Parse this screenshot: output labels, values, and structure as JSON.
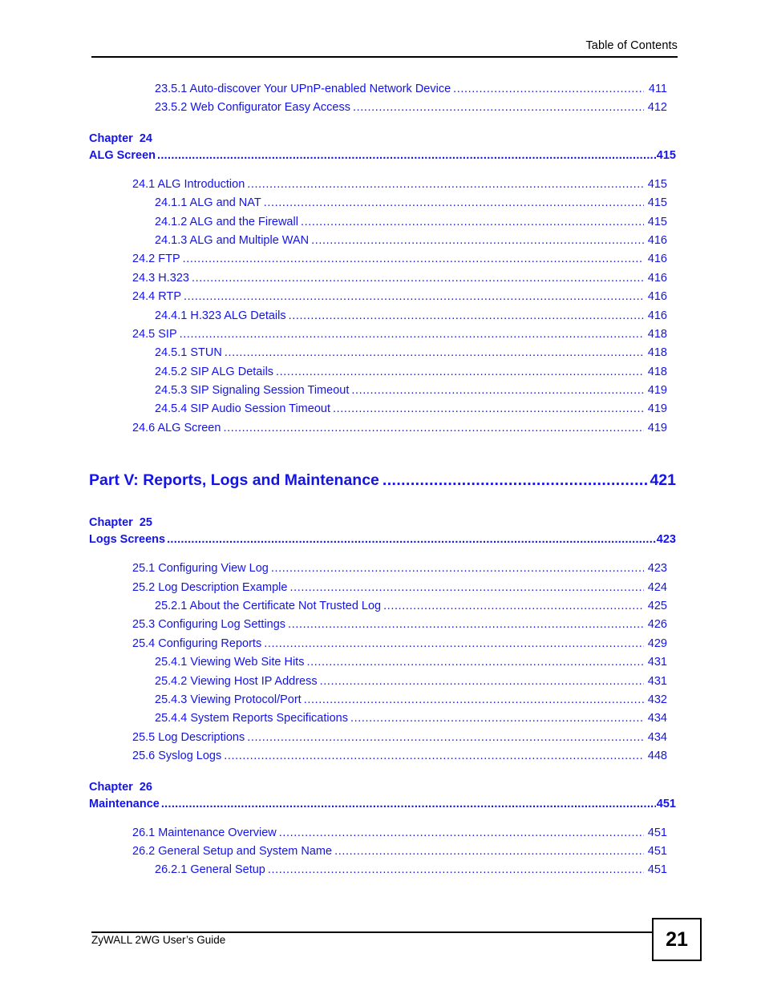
{
  "header": {
    "title": "Table of Contents"
  },
  "footer": {
    "guide_title": "ZyWALL 2WG User’s Guide",
    "page_number": "21"
  },
  "leader": "..................................................................................................................................................................",
  "toc": {
    "top_entries": [
      {
        "level": 3,
        "label": "23.5.1 Auto-discover Your UPnP-enabled Network Device",
        "page": "411"
      },
      {
        "level": 3,
        "label": "23.5.2 Web Configurator Easy Access",
        "page": "412"
      }
    ],
    "chapter_24": {
      "kicker": "Chapter  24",
      "title": "ALG Screen",
      "page": "415",
      "entries": [
        {
          "level": 2,
          "label": "24.1 ALG Introduction",
          "page": "415"
        },
        {
          "level": 3,
          "label": "24.1.1 ALG and NAT",
          "page": "415"
        },
        {
          "level": 3,
          "label": "24.1.2 ALG and the Firewall",
          "page": "415"
        },
        {
          "level": 3,
          "label": "24.1.3 ALG and Multiple WAN",
          "page": "416"
        },
        {
          "level": 2,
          "label": "24.2 FTP",
          "page": "416"
        },
        {
          "level": 2,
          "label": "24.3 H.323",
          "page": "416"
        },
        {
          "level": 2,
          "label": "24.4 RTP",
          "page": "416"
        },
        {
          "level": 3,
          "label": "24.4.1 H.323 ALG Details",
          "page": "416"
        },
        {
          "level": 2,
          "label": "24.5 SIP",
          "page": "418"
        },
        {
          "level": 3,
          "label": "24.5.1 STUN",
          "page": "418"
        },
        {
          "level": 3,
          "label": "24.5.2 SIP ALG Details",
          "page": "418"
        },
        {
          "level": 3,
          "label": "24.5.3 SIP Signaling Session Timeout",
          "page": "419"
        },
        {
          "level": 3,
          "label": "24.5.4 SIP Audio Session Timeout",
          "page": "419"
        },
        {
          "level": 2,
          "label": "24.6 ALG Screen",
          "page": "419"
        }
      ]
    },
    "part_v": {
      "label": "Part V: Reports, Logs and Maintenance",
      "page": "421"
    },
    "chapter_25": {
      "kicker": "Chapter  25",
      "title": "Logs Screens",
      "page": "423",
      "entries": [
        {
          "level": 2,
          "label": "25.1 Configuring View Log",
          "page": "423"
        },
        {
          "level": 2,
          "label": "25.2 Log Description Example",
          "page": "424"
        },
        {
          "level": 3,
          "label": "25.2.1 About the Certificate Not Trusted Log",
          "page": "425"
        },
        {
          "level": 2,
          "label": "25.3 Configuring Log Settings",
          "page": "426"
        },
        {
          "level": 2,
          "label": "25.4 Configuring Reports",
          "page": "429"
        },
        {
          "level": 3,
          "label": "25.4.1 Viewing Web Site Hits",
          "page": "431"
        },
        {
          "level": 3,
          "label": "25.4.2 Viewing Host IP Address",
          "page": "431"
        },
        {
          "level": 3,
          "label": "25.4.3 Viewing Protocol/Port",
          "page": "432"
        },
        {
          "level": 3,
          "label": "25.4.4 System Reports Specifications",
          "page": "434"
        },
        {
          "level": 2,
          "label": "25.5 Log Descriptions",
          "page": "434"
        },
        {
          "level": 2,
          "label": "25.6 Syslog Logs",
          "page": "448"
        }
      ]
    },
    "chapter_26": {
      "kicker": "Chapter  26",
      "title": "Maintenance",
      "page": "451",
      "entries": [
        {
          "level": 2,
          "label": "26.1 Maintenance Overview",
          "page": "451"
        },
        {
          "level": 2,
          "label": "26.2 General Setup and System Name",
          "page": "451"
        },
        {
          "level": 3,
          "label": "26.2.1 General Setup",
          "page": "451"
        }
      ]
    }
  }
}
